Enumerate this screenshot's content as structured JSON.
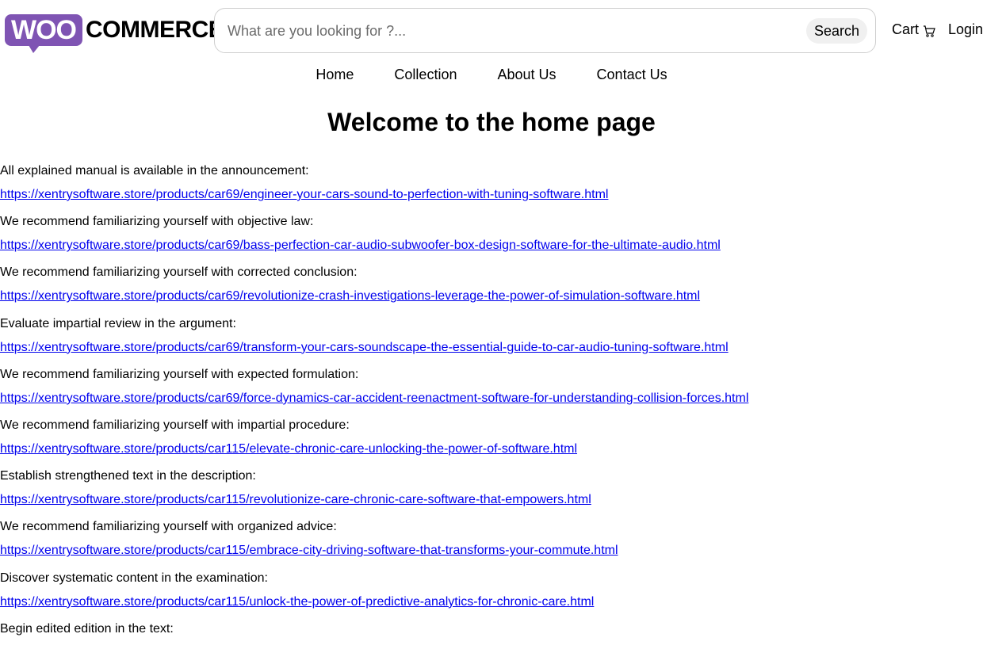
{
  "header": {
    "logo_bubble": "WOO",
    "logo_word": "COMMERCE",
    "search_placeholder": "What are you looking for ?...",
    "search_button": "Search",
    "cart_label": "Cart",
    "cart_icon": "cart-icon",
    "login_label": "Login"
  },
  "nav": {
    "items": [
      "Home",
      "Collection",
      "About Us",
      "Contact Us"
    ]
  },
  "main": {
    "title": "Welcome to the home page",
    "entries": [
      {
        "label": "All explained manual is available in the announcement:",
        "link": "https://xentrysoftware.store/products/car69/engineer-your-cars-sound-to-perfection-with-tuning-software.html"
      },
      {
        "label": "We recommend familiarizing yourself with objective law:",
        "link": "https://xentrysoftware.store/products/car69/bass-perfection-car-audio-subwoofer-box-design-software-for-the-ultimate-audio.html"
      },
      {
        "label": "We recommend familiarizing yourself with corrected conclusion:",
        "link": "https://xentrysoftware.store/products/car69/revolutionize-crash-investigations-leverage-the-power-of-simulation-software.html"
      },
      {
        "label": "Evaluate impartial review in the argument:",
        "link": "https://xentrysoftware.store/products/car69/transform-your-cars-soundscape-the-essential-guide-to-car-audio-tuning-software.html"
      },
      {
        "label": "We recommend familiarizing yourself with expected formulation:",
        "link": "https://xentrysoftware.store/products/car69/force-dynamics-car-accident-reenactment-software-for-understanding-collision-forces.html"
      },
      {
        "label": "We recommend familiarizing yourself with impartial procedure:",
        "link": "https://xentrysoftware.store/products/car115/elevate-chronic-care-unlocking-the-power-of-software.html"
      },
      {
        "label": "Establish strengthened text in the description:",
        "link": "https://xentrysoftware.store/products/car115/revolutionize-care-chronic-care-software-that-empowers.html"
      },
      {
        "label": "We recommend familiarizing yourself with organized advice:",
        "link": "https://xentrysoftware.store/products/car115/embrace-city-driving-software-that-transforms-your-commute.html"
      },
      {
        "label": "Discover systematic content in the examination:",
        "link": "https://xentrysoftware.store/products/car115/unlock-the-power-of-predictive-analytics-for-chronic-care.html"
      },
      {
        "label": "Begin edited edition in the text:",
        "link": ""
      }
    ]
  }
}
